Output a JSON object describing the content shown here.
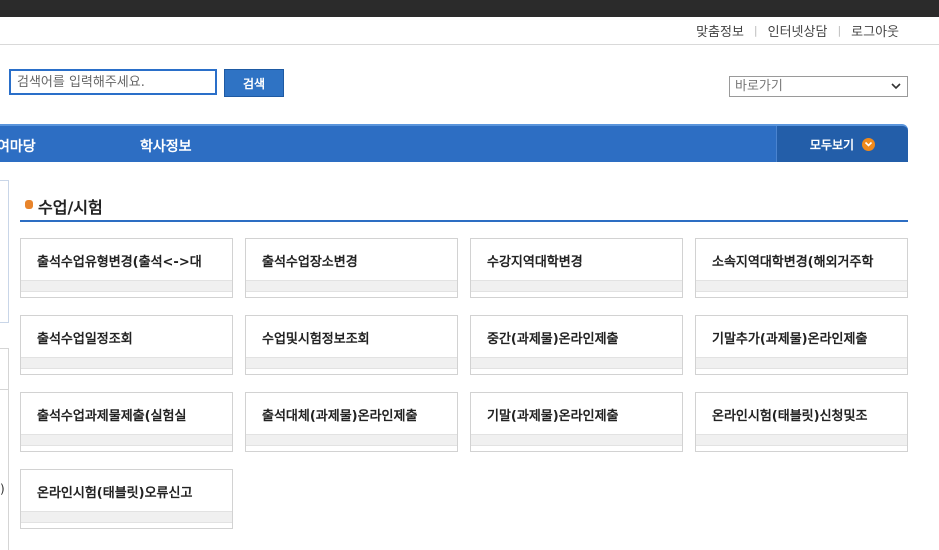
{
  "util_links": [
    "맞춤정보",
    "인터넷상담",
    "로그아웃"
  ],
  "search": {
    "placeholder": "검색어를 입력해주세요.",
    "button": "검색"
  },
  "quick_nav": {
    "selected": "바로가기"
  },
  "nav": {
    "items": [
      "여마당",
      "학사정보"
    ],
    "view_all": "모두보기"
  },
  "section": {
    "title": "수업/시험"
  },
  "tiles": [
    "출석수업유형변경(출석<->대",
    "출석수업장소변경",
    "수강지역대학변경",
    "소속지역대학변경(해외거주학",
    "출석수업일정조회",
    "수업및시험정보조회",
    "중간(과제물)온라인제출",
    "기말추가(과제물)온라인제출",
    "출석수업과제물제출(실험실",
    "출석대체(과제물)온라인제출",
    "기말(과제물)온라인제출",
    "온라인시험(태블릿)신청및조",
    "온라인시험(태블릿)오류신고"
  ],
  "left_fragment": ")",
  "colors": {
    "nav_blue": "#2d6ec3",
    "accent_orange": "#f08a1c"
  }
}
